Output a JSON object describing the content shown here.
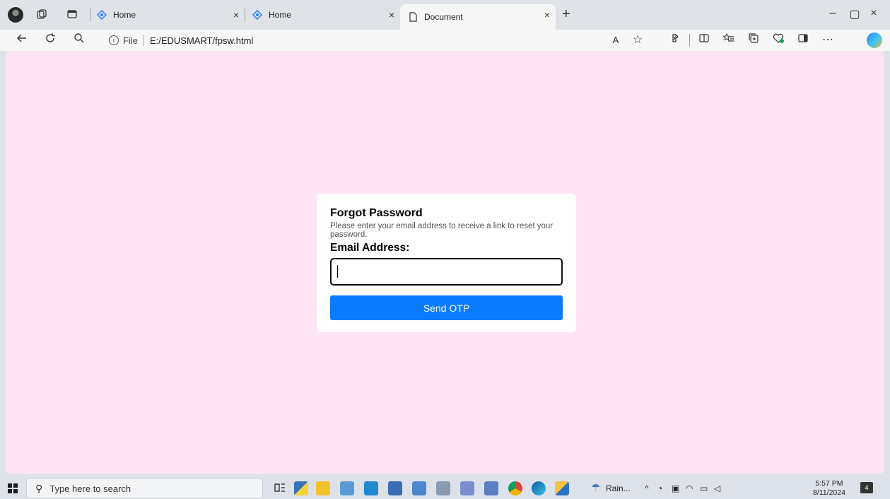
{
  "browser": {
    "tabs": [
      {
        "title": "Home",
        "active": false
      },
      {
        "title": "Home",
        "active": false
      },
      {
        "title": "Document",
        "active": true
      }
    ],
    "close_glyph": "×",
    "new_tab_glyph": "+",
    "window_controls": {
      "minimize": "–",
      "restore": "▢",
      "close": "×"
    },
    "address": {
      "scheme_label": "File",
      "url": "E:/EDUSMART/fpsw.html",
      "info_glyph": "i"
    },
    "toolbar_icons": [
      "read-aloud-icon",
      "favorite-star-icon",
      "extensions-icon",
      "split-screen-icon",
      "favorites-list-icon",
      "collections-icon",
      "browser-essentials-icon",
      "sidebar-icon",
      "more-icon",
      "copilot-icon"
    ],
    "toolbar_glyphs": {
      "read_aloud": "A",
      "star": "☆",
      "more": "⋯"
    }
  },
  "page": {
    "background": "#fce4f4",
    "card": {
      "title": "Forgot Password",
      "description": "Please enter your email address to receive a link to reset your password.",
      "email_label": "Email Address:",
      "email_value": "",
      "button_label": "Send OTP",
      "button_color": "#0a7bff"
    }
  },
  "taskbar": {
    "search_placeholder": "Type here to search",
    "weather": "Rain...",
    "time": "5:57 PM",
    "date": "8/11/2024",
    "notification_count": "4",
    "pinned_apps": [
      "task-view",
      "python",
      "file-explorer",
      "store",
      "vscode",
      "app",
      "app",
      "app",
      "snipping-tool",
      "notepad",
      "chrome",
      "edge",
      "explorer"
    ]
  }
}
